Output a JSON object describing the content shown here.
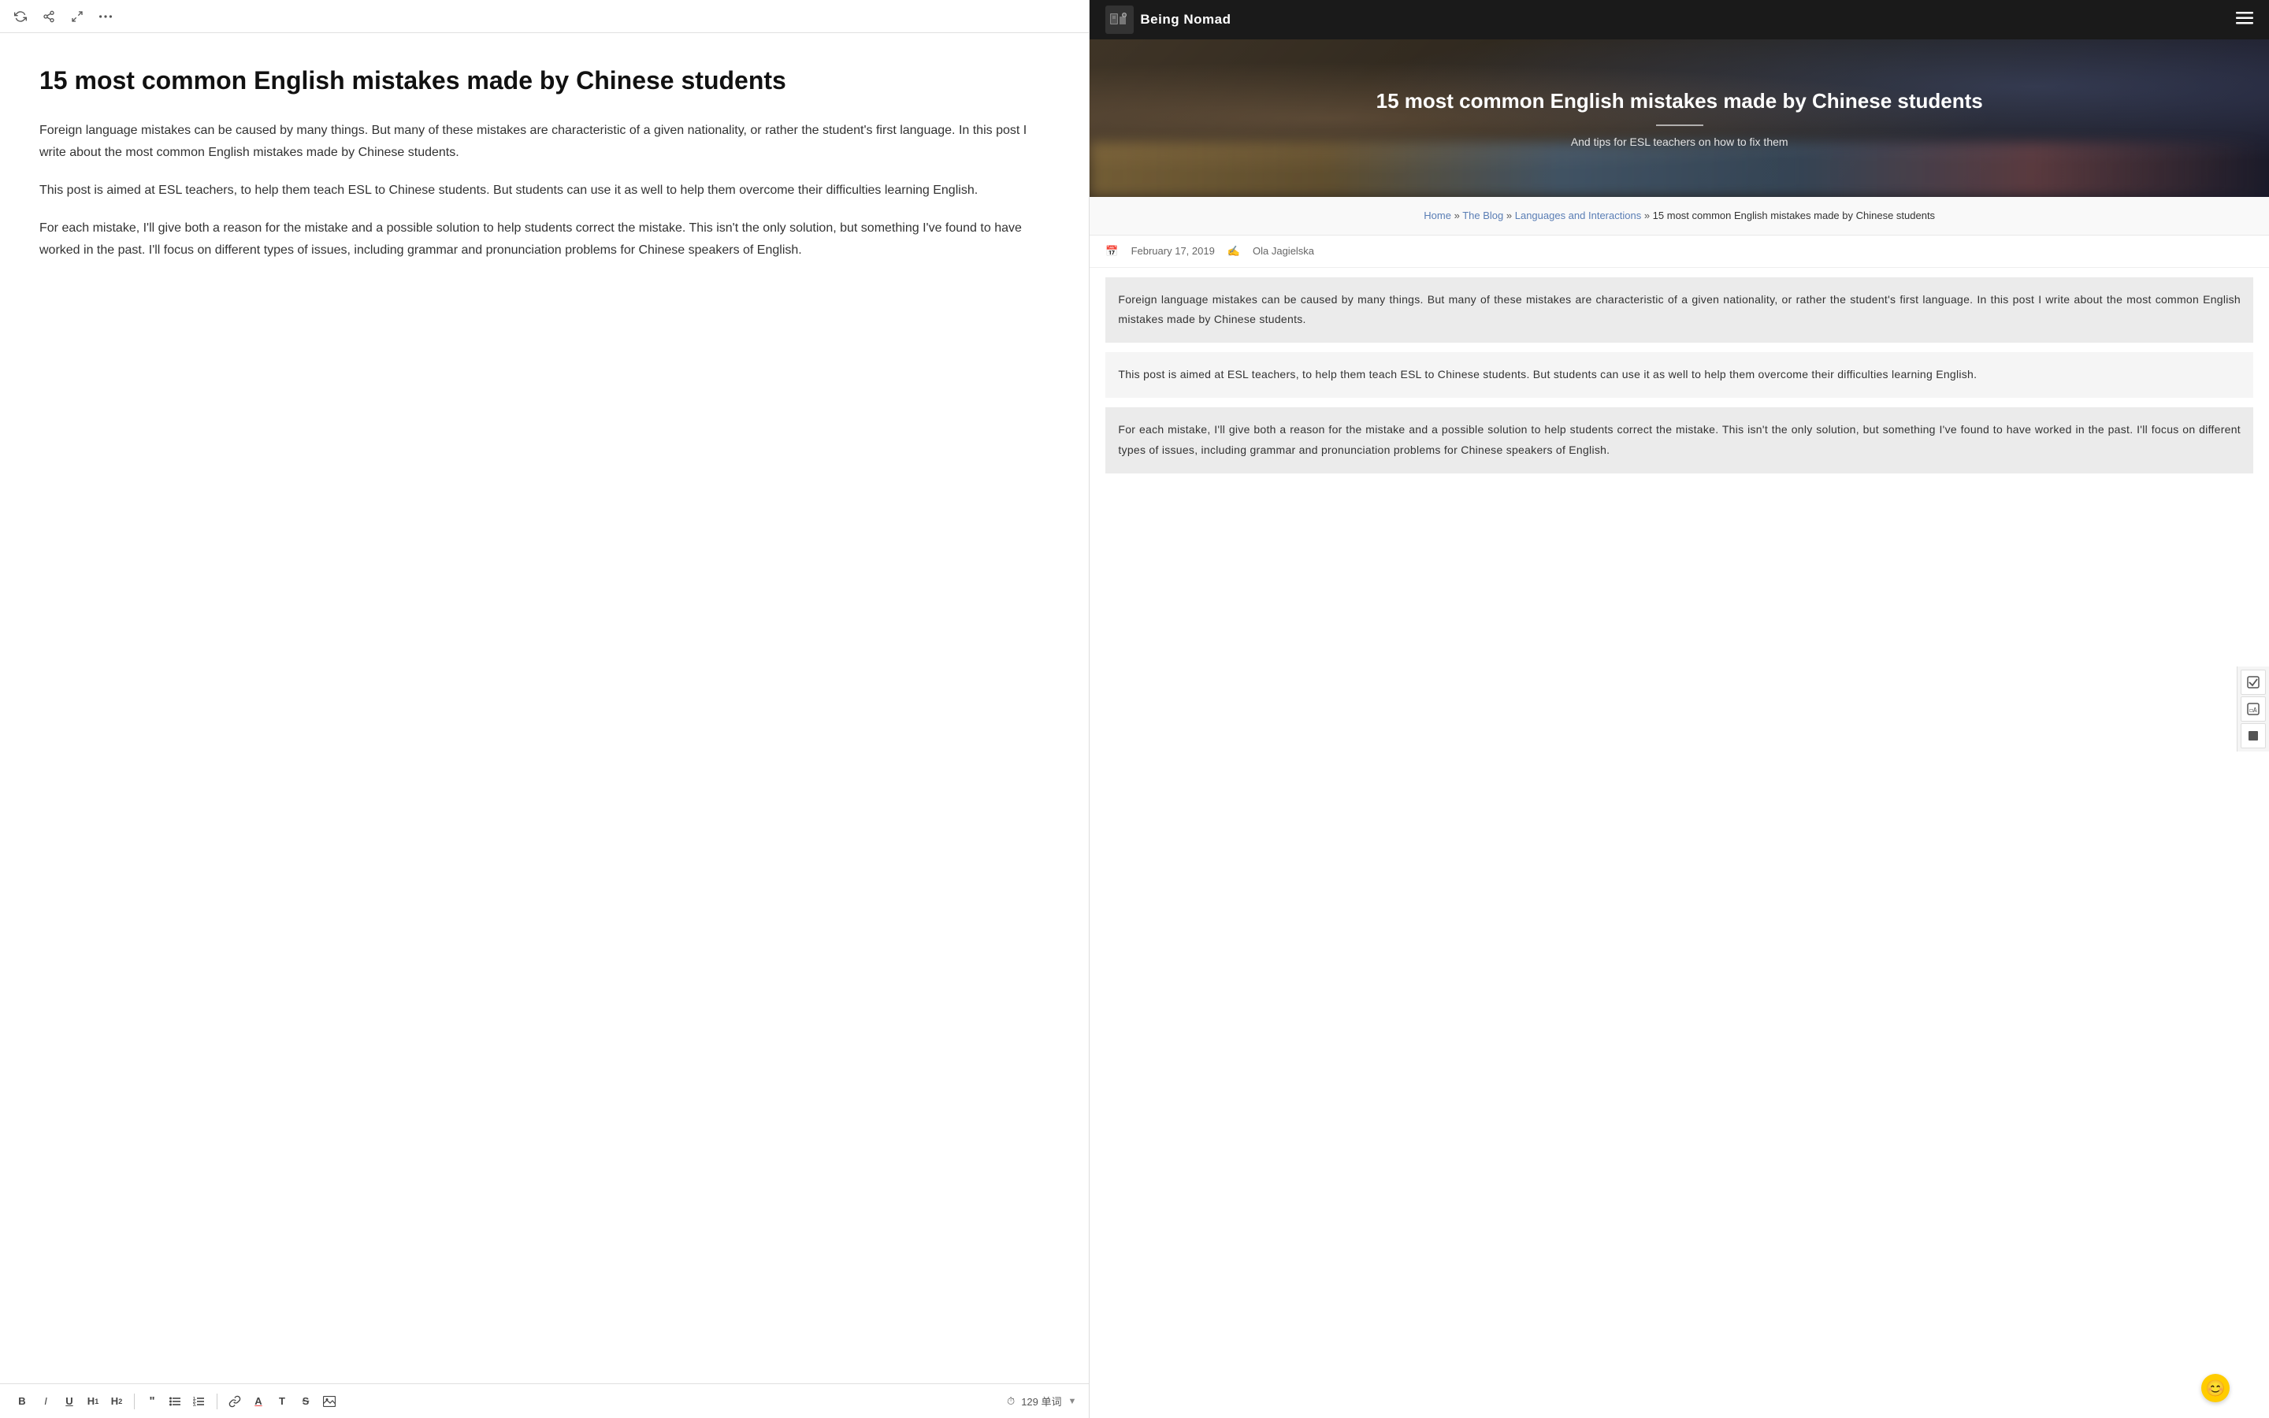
{
  "editor": {
    "toolbar_top": {
      "refresh_label": "↻",
      "share_label": "↗",
      "expand_label": "⤢",
      "more_label": "···"
    },
    "title": "15 most common English mistakes made by Chinese students",
    "paragraphs": [
      "Foreign language mistakes can be caused by many things. But many of these mistakes are characteristic of a given nationality, or rather the student's first language. In this post I write about the most common English mistakes made by Chinese students.",
      "This post is aimed at ESL teachers, to help them teach ESL to Chinese students. But students can use it as well to help them overcome their difficulties learning English.",
      "For each mistake, I'll give both a reason for the mistake and a possible solution to help students correct the mistake. This isn't the only solution, but something I've found to have worked in the past. I'll focus on different types of issues, including grammar and pronunciation problems for Chinese speakers of English."
    ],
    "bottom_toolbar": {
      "bold": "B",
      "italic": "I",
      "underline": "U",
      "heading1": "H",
      "heading2": "H",
      "quote": "“",
      "list_ul": "≡",
      "list_ol": "≡",
      "link": "🔗",
      "underline2": "A",
      "text": "T",
      "strikethrough": "S",
      "image": "⊞",
      "clock_icon": "⏱",
      "word_count": "129 单词"
    }
  },
  "website": {
    "nav": {
      "logo_text": "Being Nomad",
      "logo_icon": "🧭",
      "menu_icon": "☰"
    },
    "hero": {
      "title": "15 most common English mistakes made by Chinese students",
      "subtitle": "And tips for ESL teachers on how to fix them"
    },
    "breadcrumb": {
      "home": "Home",
      "blog": "The Blog",
      "category": "Languages and Interactions",
      "current": "15 most common English mistakes made by Chinese students"
    },
    "meta": {
      "date": "February 17, 2019",
      "author": "Ola Jagielska"
    },
    "paragraphs": [
      "Foreign language mistakes can be caused by many things. But many of these mistakes are characteristic of a given nationality, or rather the student's first language. In this post I write about the most common English mistakes made by Chinese students.",
      "This post is aimed at ESL teachers, to help them teach ESL to Chinese students. But students can use it as well to help them overcome their difficulties learning English.",
      "For each mistake, I'll give both a reason for the mistake and a possible solution to help students correct the mistake. This isn't the only solution, but something I've found to have worked in the past. I'll focus on different types of issues, including grammar and pronunciation problems for Chinese speakers of English."
    ]
  },
  "sidebar": {
    "check_icon": "✓",
    "format_icon": "◻A",
    "layer_icon": "⬛"
  },
  "emoji": "😊"
}
